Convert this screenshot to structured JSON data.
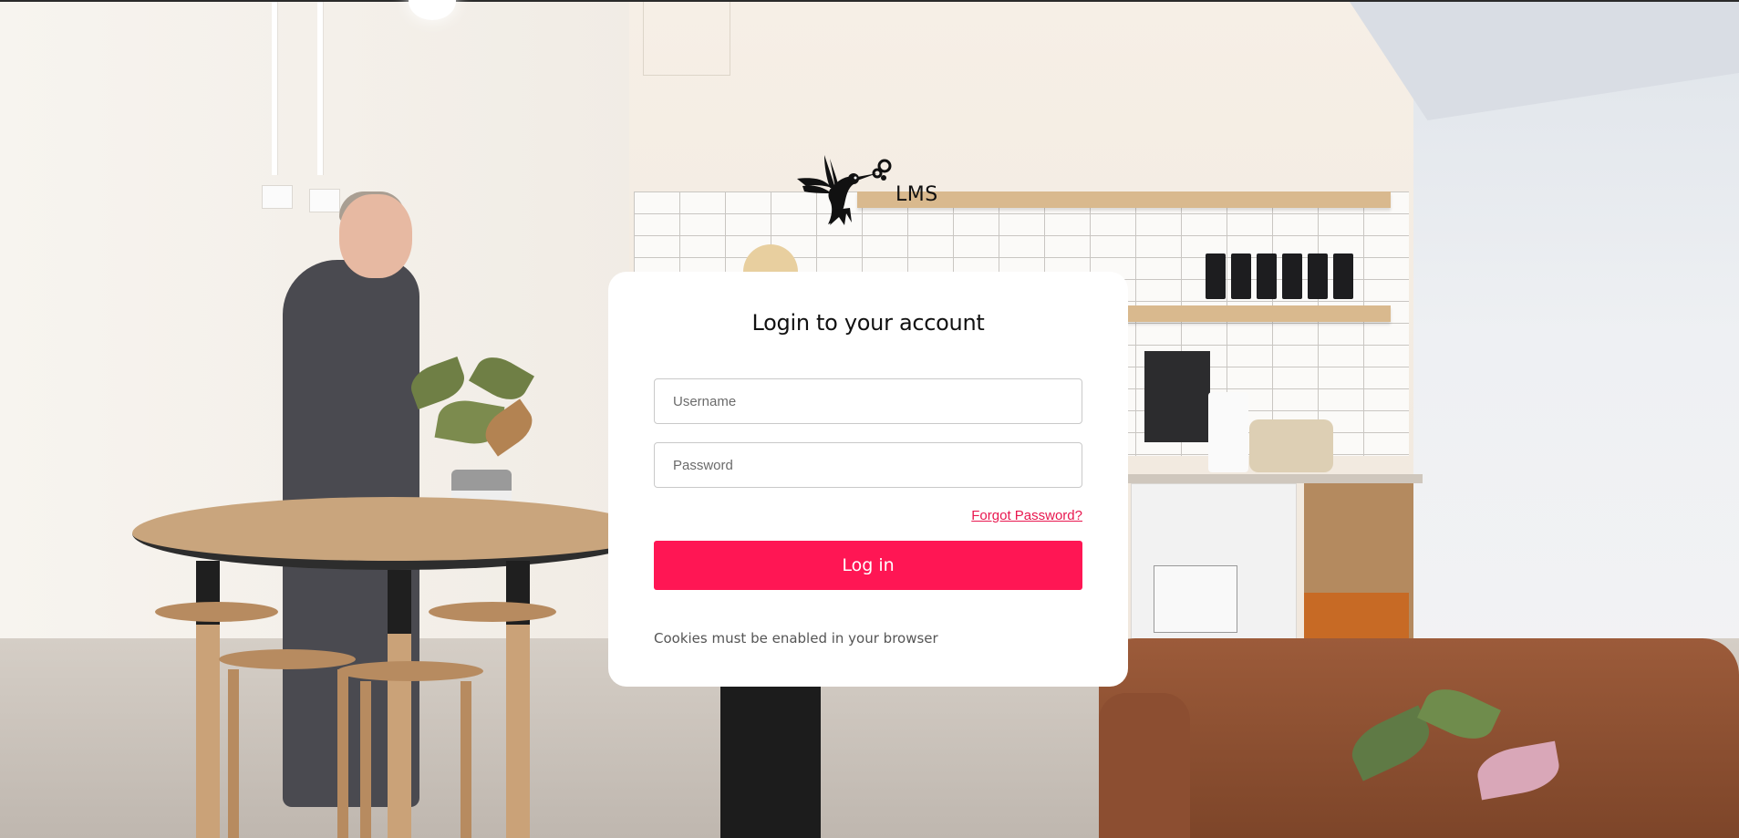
{
  "brand": {
    "logo_icon": "hummingbird-icon",
    "name": "LMS"
  },
  "login": {
    "title": "Login to your account",
    "username_placeholder": "Username",
    "username_value": "",
    "password_placeholder": "Password",
    "password_value": "",
    "forgot_password_label": "Forgot Password?",
    "submit_label": "Log in",
    "cookies_notice": "Cookies must be enabled in your browser"
  },
  "colors": {
    "accent": "#ff1654",
    "link": "#e8174f",
    "card_background": "#ffffff",
    "title_text": "#111111"
  }
}
